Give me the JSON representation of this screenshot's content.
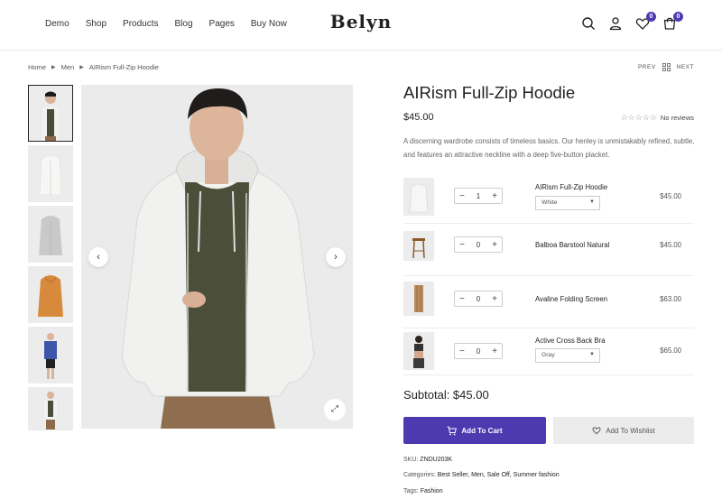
{
  "header": {
    "nav": [
      "Demo",
      "Shop",
      "Products",
      "Blog",
      "Pages",
      "Buy Now"
    ],
    "logo": "Belyn",
    "icons": [
      "search-icon",
      "user-icon",
      "heart-icon",
      "cart-icon"
    ],
    "wishlist_count": "0",
    "cart_count": "0",
    "accent": "#4d3ab0"
  },
  "breadcrumb": [
    "Home",
    "Men",
    "AIRism Full-Zip Hoodie"
  ],
  "pager": {
    "prev": "PREV",
    "next": "NEXT"
  },
  "product": {
    "title": "AIRism Full-Zip Hoodie",
    "price": "$45.00",
    "reviews": "No reviews",
    "description": "A discerning wardrobe consists of timeless basics. Our henley is unmistakably refined, subtle, and features an attractive neckline with a deep five-button placket."
  },
  "bundle": [
    {
      "name": "AIRism Full-Zip Hoodie",
      "qty": "1",
      "variant": "White",
      "price": "$45.00"
    },
    {
      "name": "Balboa Barstool Natural",
      "qty": "0",
      "price": "$45.00"
    },
    {
      "name": "Avaline Folding Screen",
      "qty": "0",
      "price": "$63.00"
    },
    {
      "name": "Active Cross Back Bra",
      "qty": "0",
      "variant": "Gray",
      "price": "$65.00"
    }
  ],
  "subtotal": "Subtotal: $45.00",
  "buttons": {
    "add_to_cart": "Add To Cart",
    "add_to_wishlist": "Add To Wishlist"
  },
  "meta": {
    "sku_label": "SKU:",
    "sku": "ZNDU203K",
    "categories_label": "Categories:",
    "categories": "Best Seller, Men, Sale Off, Summer fashion",
    "tags_label": "Tags:",
    "tags": "Fashion"
  }
}
